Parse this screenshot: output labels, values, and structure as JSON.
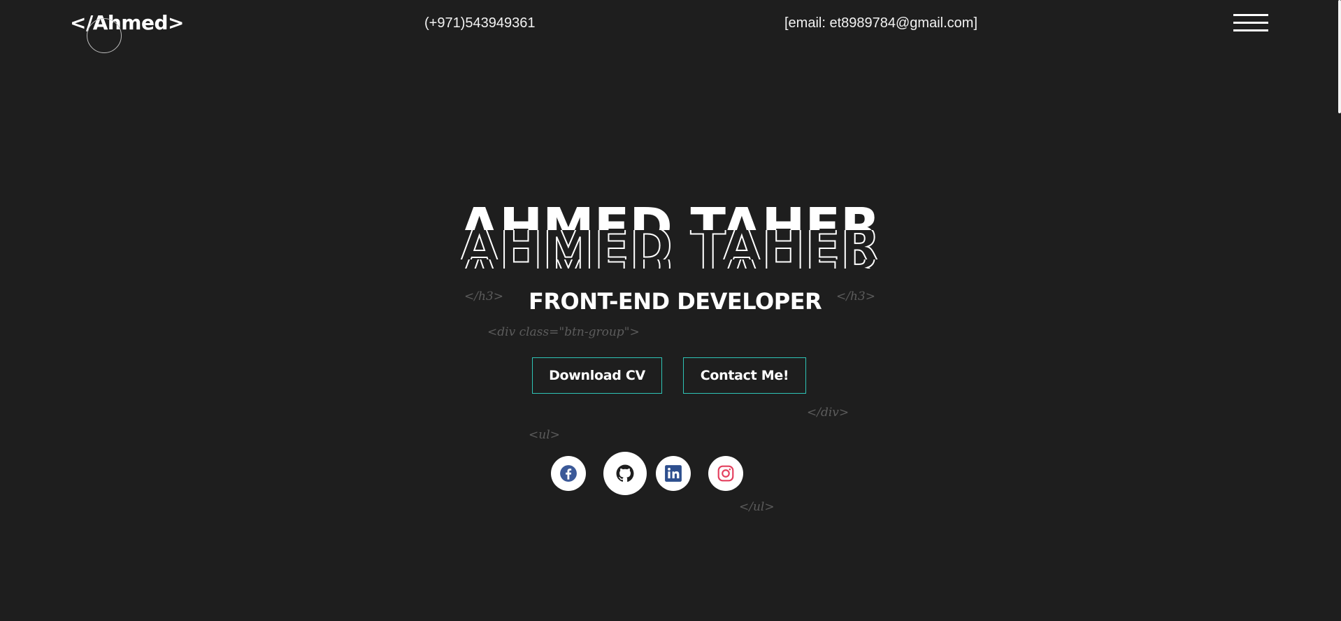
{
  "header": {
    "logo": "</Ahmed>",
    "phone": "(+971)543949361",
    "email": "[email: et8989784@gmail.com]",
    "menu_icon": "hamburger-icon"
  },
  "hero": {
    "name": "AHMED TAHER",
    "title": "FRONT-END DEVELOPER",
    "code_tags": {
      "h3_close_left": "</h3>",
      "h3_close_right": "</h3>",
      "div_open": "<div class=\"btn-group\">",
      "div_close": "</div>",
      "ul_open": "<ul>",
      "ul_close": "</ul>"
    },
    "buttons": {
      "download_cv": "Download CV",
      "contact_me": "Contact Me!"
    }
  },
  "socials": [
    {
      "icon": "facebook-icon",
      "color": "#3b5998"
    },
    {
      "icon": "github-icon",
      "color": "#1e1e1e"
    },
    {
      "icon": "linkedin-icon",
      "color": "#2d4f8e"
    },
    {
      "icon": "instagram-icon",
      "color": "#e4405f"
    }
  ],
  "colors": {
    "background": "#1e1e1e",
    "accent_border": "#2ec4b6",
    "code_tag": "#5c5c5c"
  }
}
